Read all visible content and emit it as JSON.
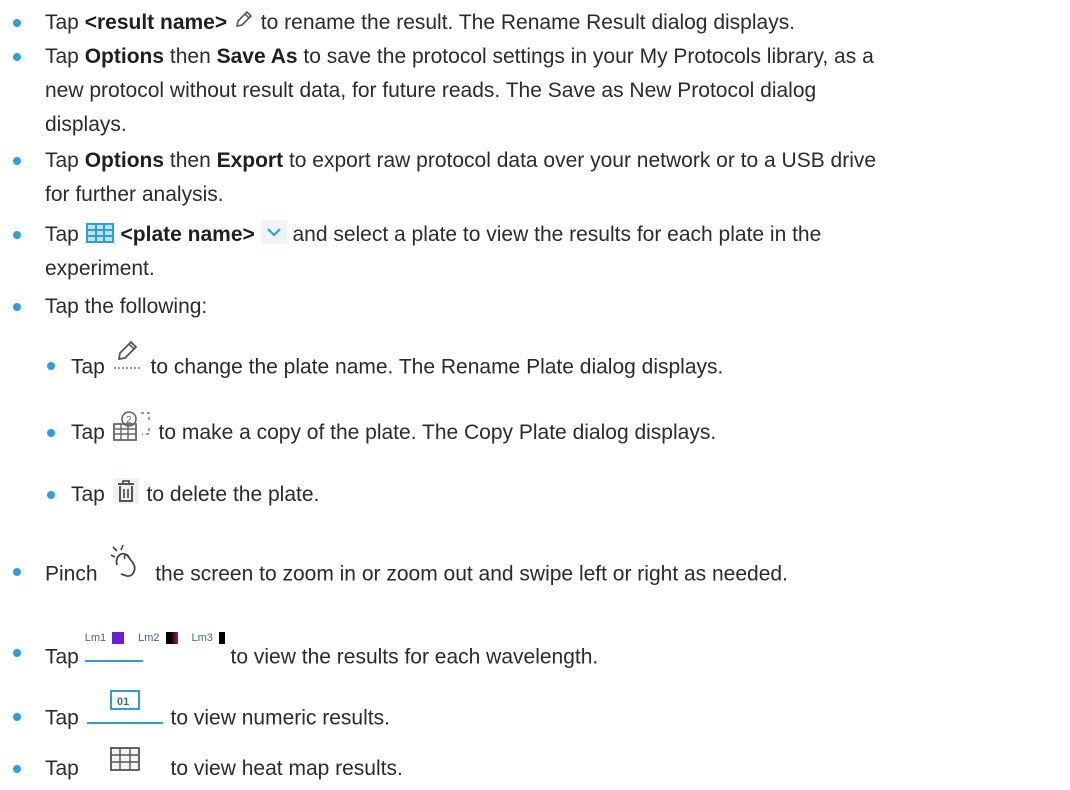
{
  "items": [
    {
      "tap": "Tap",
      "bold1": "<result name>",
      "after": "to rename the result. The Rename Result dialog displays."
    },
    {
      "line1_pre": "Tap",
      "bold1": "Options",
      "mid": "then",
      "bold2": "Save As",
      "line1_post": "to save the protocol settings in your My Protocols library, as a",
      "line2": "new protocol without result data, for future reads. The Save as New Protocol dialog",
      "line3": "displays."
    },
    {
      "line1_pre": "Tap",
      "bold1": "Options",
      "mid": "then",
      "bold2": "Export",
      "line1_post": "to export raw protocol data over your network or to a USB drive",
      "line2": "for further analysis."
    },
    {
      "tap": "Tap",
      "bold1": "<plate name>",
      "after": "and select a plate to view the results for each plate in the",
      "line2": "experiment."
    },
    {
      "text": "Tap the following:"
    },
    {
      "tap": "Tap",
      "after": "to change the plate name. The Rename Plate dialog displays."
    },
    {
      "tap": "Tap",
      "after": "to make a copy of the plate. The Copy Plate dialog displays."
    },
    {
      "tap": "Tap",
      "after": "to delete the plate."
    },
    {
      "tap": "Pinch",
      "after": "the screen to zoom in or zoom out and swipe left or right as needed."
    },
    {
      "tap": "Tap",
      "after": "to view the results for each wavelength."
    },
    {
      "tap": "Tap",
      "after": "to view numeric results."
    },
    {
      "tap": "Tap",
      "after": "to view heat map results."
    }
  ],
  "wave_tabs": [
    "Lm1",
    "Lm2",
    "Lm3"
  ],
  "numeric_icon_label": "01",
  "colors": {
    "bullet": "#2e9fd8",
    "icon_blue": "#2e9fd8",
    "lm1": "#6a1fd0",
    "lm2_a": "#000000",
    "lm2_b": "#b3127a"
  }
}
